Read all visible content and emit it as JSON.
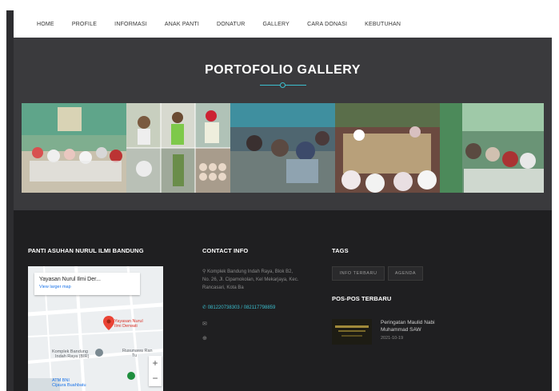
{
  "nav": {
    "items": [
      "HOME",
      "PROFILE",
      "INFORMASI",
      "ANAK PANTI",
      "DONATUR",
      "GALLERY",
      "CARA DONASI",
      "KEBUTUHAN"
    ]
  },
  "gallery": {
    "title": "PORTOFOLIO GALLERY"
  },
  "footer": {
    "about": {
      "heading": "PANTI ASUHAN NURUL ILMI BANDUNG"
    },
    "map": {
      "place_name": "Yayasan Nurul Ilmi Der...",
      "larger_map_link": "View larger map",
      "marker_label_line1": "Yayasan Nurul",
      "marker_label_line2": "Ilmi Derwati",
      "poi1_line1": "Komplek Bandung",
      "poi1_line2": "Indah Raya (BIR)",
      "poi2_line1": "Rusunawa Ran",
      "poi2_line2": "Tu",
      "poi3_line1": "ATM BNI",
      "poi3_line2": "Cijaura Buahbatu",
      "zoom_in": "+",
      "zoom_out": "−"
    },
    "contact": {
      "heading": "CONTACT INFO",
      "address_line1": "Komplek Bandung Indah Raya, Blok B2,",
      "address_line2": "No. 26, Jl. Cipamokolan, Kel Mekarjaya, Kec.",
      "address_line3": "Rancasari, Kota Ba",
      "phone": "081220738303 / 082117798859"
    },
    "tags": {
      "heading": "TAGS",
      "items": [
        "INFO TERBARU",
        "AGENDA"
      ]
    },
    "posts": {
      "heading": "POS-POS TERBARU",
      "items": [
        {
          "title": "Peringatan Maulid Nabi Muhammad SAW",
          "date": "2021-10-19"
        }
      ]
    }
  },
  "colors": {
    "accent": "#3bbfcf",
    "gallery_bg": "#3a3a3d",
    "footer_bg": "#1f1f21"
  }
}
